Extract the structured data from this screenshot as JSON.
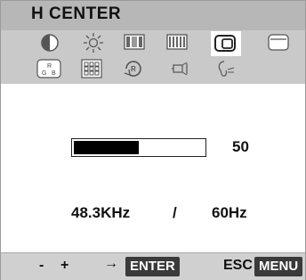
{
  "header": {
    "title": "H CENTER"
  },
  "icons": {
    "row1": [
      {
        "name": "contrast-icon"
      },
      {
        "name": "brightness-icon"
      },
      {
        "name": "h-position-icon"
      },
      {
        "name": "v-position-icon"
      },
      {
        "name": "h-size-icon"
      },
      {
        "name": "v-size-icon"
      }
    ],
    "row2": [
      {
        "name": "rgb-color-icon"
      },
      {
        "name": "grid-pattern-icon"
      },
      {
        "name": "reset-icon"
      },
      {
        "name": "degauss-icon"
      },
      {
        "name": "recall-icon"
      }
    ],
    "row2_text": {
      "rgb_r": "R",
      "rgb_g": "G",
      "rgb_b": "B",
      "reset_letter": "R"
    },
    "selected": "h-size-icon"
  },
  "adjust": {
    "value": 50,
    "value_text": "50"
  },
  "frequency": {
    "horizontal": "48.3KHz",
    "separator": "/",
    "vertical": "60Hz"
  },
  "footer": {
    "minus": "-",
    "plus": "+",
    "arrow": "→",
    "enter": "ENTER",
    "esc": "ESC",
    "menu": "MENU"
  },
  "colors": {
    "title_bar": "#b7b7b7",
    "icon_panel": "#c9c9c9",
    "bar_fill": "#000000",
    "footer": "#d0d0d0"
  }
}
